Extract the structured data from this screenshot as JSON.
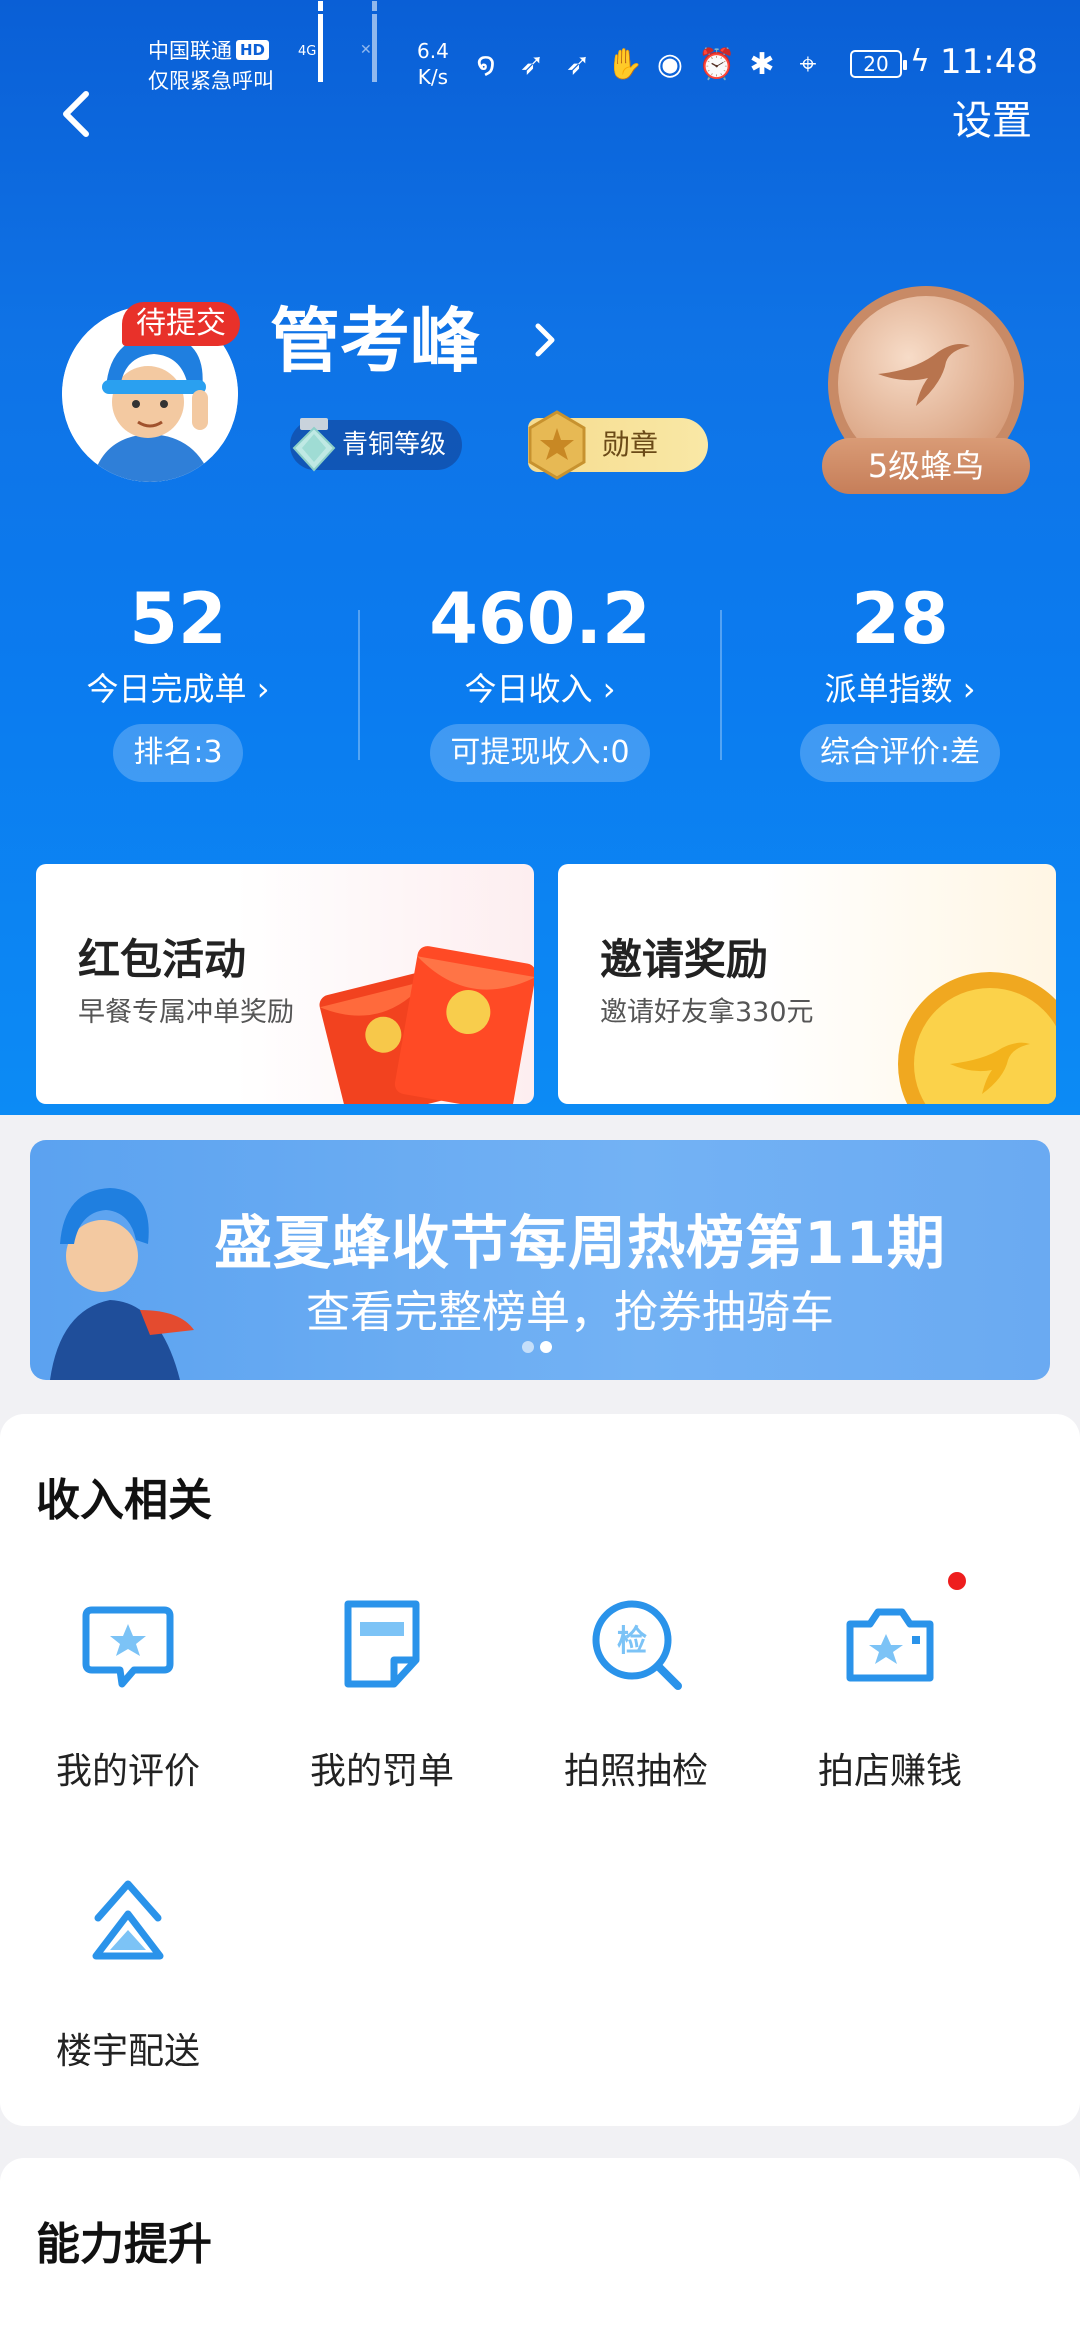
{
  "status_bar": {
    "carrier_line1": "中国联通",
    "hd": "HD",
    "carrier_line2": "仅限紧急呼叫",
    "net_speed_value": "6.4",
    "net_speed_unit": "K/s",
    "battery": "20",
    "time": "11:48"
  },
  "header": {
    "settings_label": "设置"
  },
  "profile": {
    "pending_tag": "待提交",
    "name": "管考峰",
    "level_badge": "青铜等级",
    "medal_badge": "勋章",
    "rank_title": "5级蜂鸟"
  },
  "stats": [
    {
      "value": "52",
      "label": "今日完成单",
      "pill": "排名:3"
    },
    {
      "value": "460.2",
      "label": "今日收入",
      "pill": "可提现收入:0"
    },
    {
      "value": "28",
      "label": "派单指数",
      "pill": "综合评价:差"
    }
  ],
  "promo_cards": [
    {
      "title": "红包活动",
      "subtitle": "早餐专属冲单奖励"
    },
    {
      "title": "邀请奖励",
      "subtitle": "邀请好友拿330元"
    }
  ],
  "banner": {
    "title": "盛夏蜂收节每周热榜第11期",
    "subtitle": "查看完整榜单，抢券抽骑车"
  },
  "income_section": {
    "title": "收入相关",
    "tools": [
      {
        "label": "我的评价",
        "icon": "star-chat-icon"
      },
      {
        "label": "我的罚单",
        "icon": "ticket-note-icon"
      },
      {
        "label": "拍照抽检",
        "icon": "inspect-search-icon"
      },
      {
        "label": "拍店赚钱",
        "icon": "camera-icon"
      },
      {
        "label": "楼宇配送",
        "icon": "building-delivery-icon"
      }
    ]
  },
  "ability_section": {
    "title": "能力提升"
  },
  "colors": {
    "primary_blue": "#0f73e6",
    "icon_blue": "#2a93ea",
    "alert_red": "#e8312a"
  }
}
